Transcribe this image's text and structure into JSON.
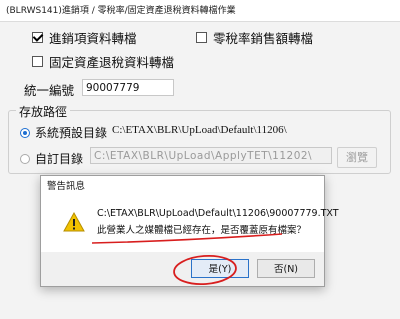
{
  "window": {
    "title": "(BLRWS141)進銷項 / 零稅率/固定資產退稅資料轉檔作業"
  },
  "options": {
    "sales_purchase": {
      "label": "進銷項資料轉檔",
      "checked": true
    },
    "zero_tax": {
      "label": "零稅率銷售額轉檔",
      "checked": false
    },
    "fixed_asset": {
      "label": "固定資產退稅資料轉檔",
      "checked": false
    }
  },
  "tax_id": {
    "label": "統一編號",
    "value": "90007779"
  },
  "storage": {
    "title": "存放路徑",
    "default_option": {
      "label": "系統預設目錄",
      "path": "C:\\ETAX\\BLR\\UpLoad\\Default\\11206\\",
      "selected": true
    },
    "custom_option": {
      "label": "自訂目錄",
      "path": "C:\\ETAX\\BLR\\UpLoad\\ApplyTET\\11202\\",
      "selected": false
    },
    "browse_label": "瀏覽"
  },
  "dialog": {
    "title": "警告訊息",
    "icon": "warning-icon",
    "message_path": "C:\\ETAX\\BLR\\UpLoad\\Default\\11206\\90007779.TXT",
    "message_text": "此營業人之媒體檔已經存在，是否覆蓋原有檔案？",
    "yes_label": "是(Y)",
    "no_label": "否(N)"
  },
  "colors": {
    "annotation": "#d81e1e",
    "primary_border": "#2a72c9",
    "warning": "#f2c200"
  }
}
